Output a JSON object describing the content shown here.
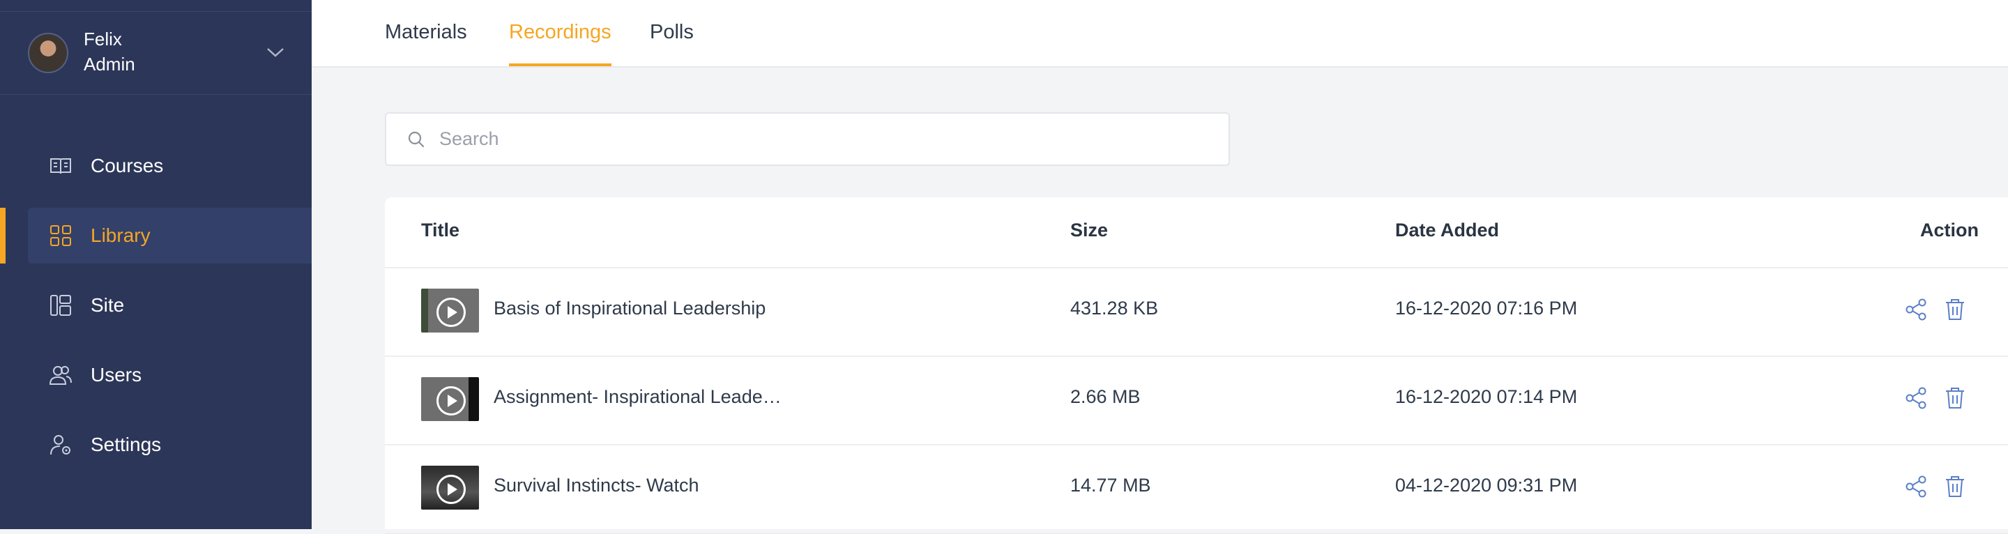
{
  "user": {
    "name": "Felix",
    "role": "Admin"
  },
  "sidebar": {
    "items": [
      {
        "label": "Courses",
        "icon": "book-icon"
      },
      {
        "label": "Library",
        "icon": "grid-icon",
        "active": true
      },
      {
        "label": "Site",
        "icon": "layout-icon"
      },
      {
        "label": "Users",
        "icon": "users-icon"
      },
      {
        "label": "Settings",
        "icon": "user-gear-icon"
      }
    ]
  },
  "tabs": [
    {
      "label": "Materials"
    },
    {
      "label": "Recordings",
      "active": true
    },
    {
      "label": "Polls"
    }
  ],
  "search": {
    "placeholder": "Search",
    "value": ""
  },
  "table": {
    "headers": {
      "title": "Title",
      "size": "Size",
      "date": "Date Added",
      "action": "Action"
    },
    "rows": [
      {
        "title": "Basis of Inspirational Leadership",
        "size": "431.28 KB",
        "date": "16-12-2020 07:16 PM"
      },
      {
        "title": "Assignment- Inspirational Leade…",
        "size": "2.66 MB",
        "date": "16-12-2020 07:14 PM"
      },
      {
        "title": "Survival Instincts- Watch",
        "size": "14.77 MB",
        "date": "04-12-2020 09:31 PM"
      }
    ]
  },
  "colors": {
    "sidebar_bg": "#2c3658",
    "accent": "#f5a623",
    "action_icon": "#5b7fc7"
  }
}
